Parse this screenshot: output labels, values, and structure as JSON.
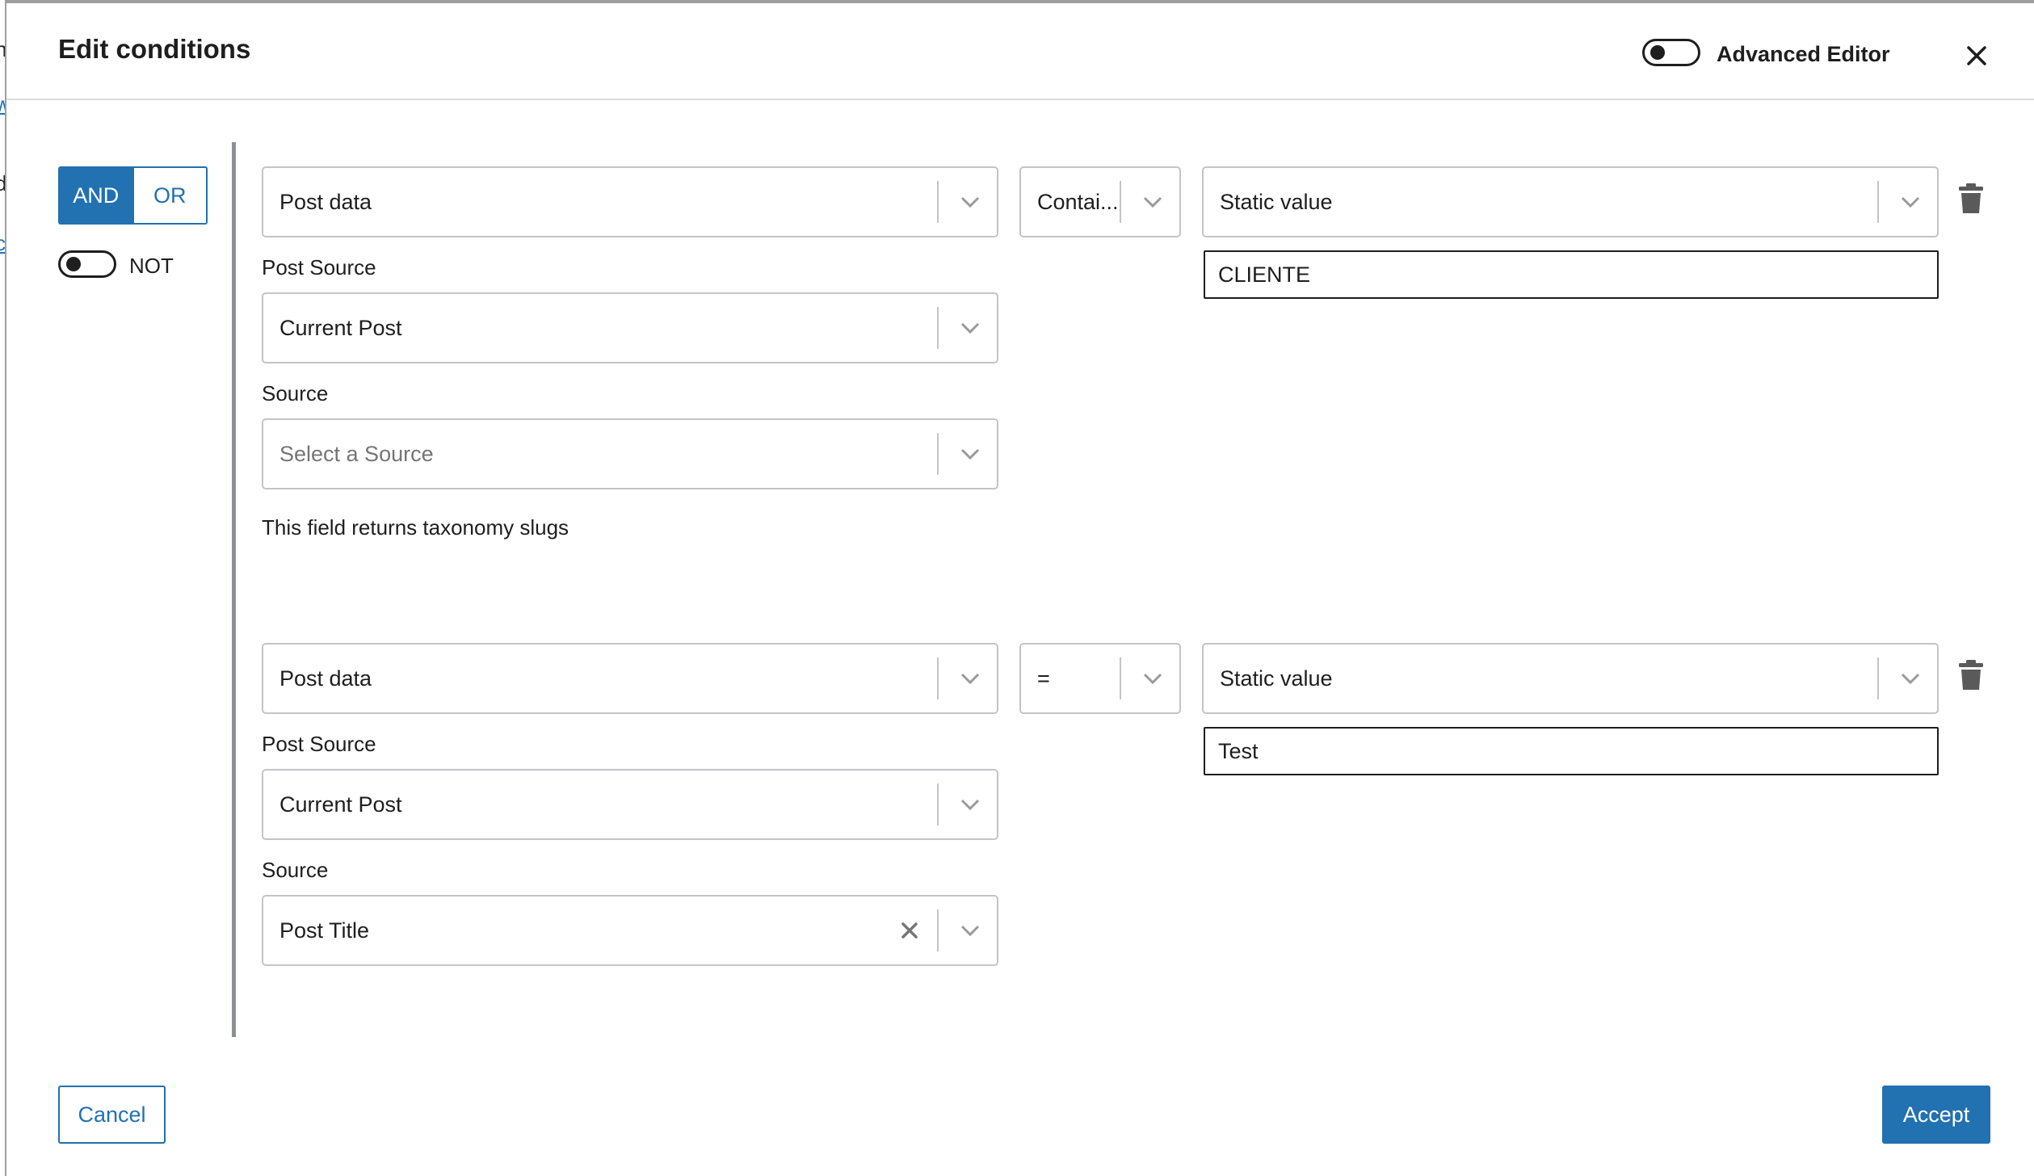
{
  "background_fragments": [
    "n",
    "w",
    "d",
    "c"
  ],
  "header": {
    "title": "Edit conditions",
    "advanced_editor_label": "Advanced Editor",
    "advanced_editor_on": false
  },
  "logic": {
    "and_label": "AND",
    "or_label": "OR",
    "active": "AND",
    "not_label": "NOT",
    "not_on": false
  },
  "conditions": [
    {
      "field": "Post data",
      "post_source_label": "Post Source",
      "post_source": "Current Post",
      "source_label": "Source",
      "source_placeholder": "Select a Source",
      "source": "",
      "help": "This field returns taxonomy slugs",
      "operator": "Contai...",
      "value_type": "Static value",
      "value": "CLIENTE"
    },
    {
      "field": "Post data",
      "post_source_label": "Post Source",
      "post_source": "Current Post",
      "source_label": "Source",
      "source": "Post Title",
      "operator": "=",
      "value_type": "Static value",
      "value": "Test"
    }
  ],
  "footer": {
    "cancel_label": "Cancel",
    "accept_label": "Accept"
  },
  "colors": {
    "accent": "#2271b1",
    "border": "#c3c4c7",
    "text": "#1e1e1e",
    "placeholder": "#757575"
  }
}
